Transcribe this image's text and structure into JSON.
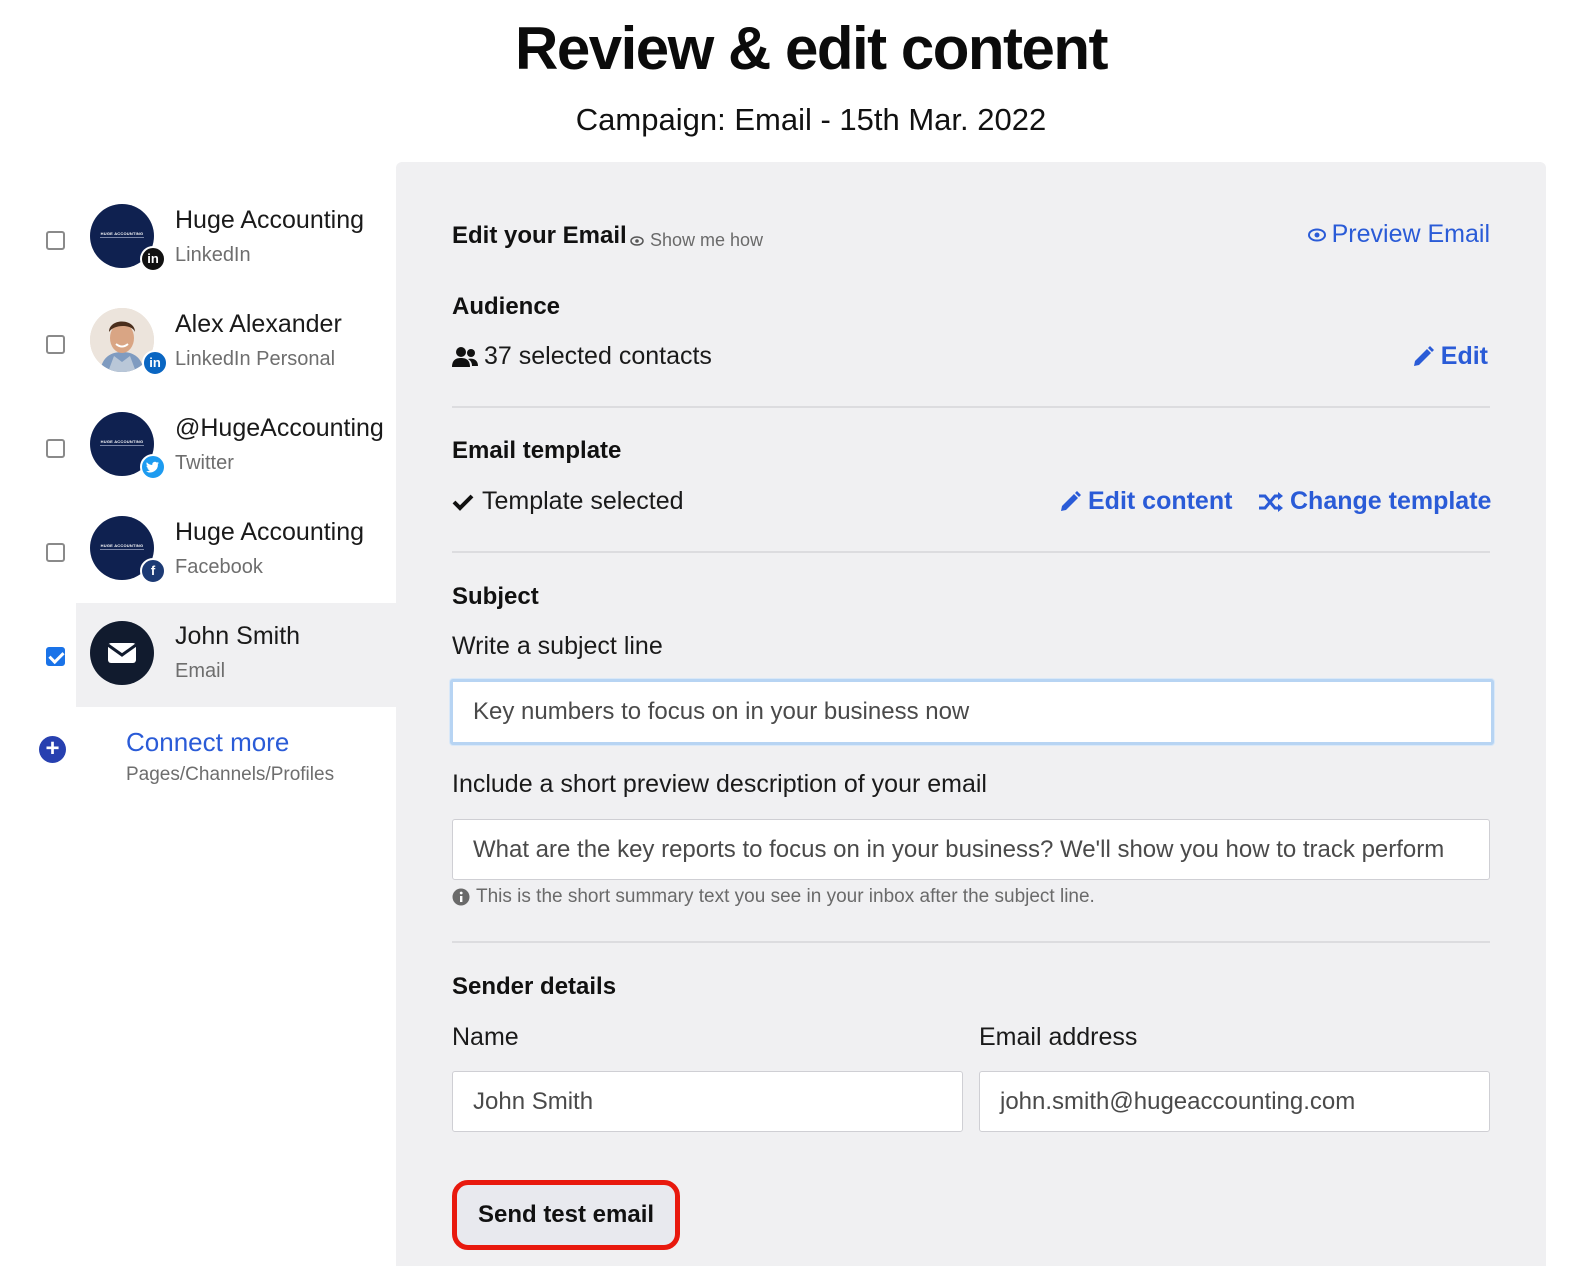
{
  "header": {
    "title": "Review & edit content",
    "subtitle": "Campaign: Email - 15th Mar. 2022"
  },
  "sidebar": {
    "accounts": [
      {
        "name": "Huge Accounting",
        "type": "LinkedIn",
        "checked": false,
        "logo_text": "HUGE ACCOUNTING"
      },
      {
        "name": "Alex Alexander",
        "type": "LinkedIn Personal",
        "checked": false
      },
      {
        "name": "@HugeAccounting",
        "type": "Twitter",
        "checked": false,
        "logo_text": "HUGE ACCOUNTING"
      },
      {
        "name": "Huge Accounting",
        "type": "Facebook",
        "checked": false,
        "logo_text": "HUGE ACCOUNTING"
      },
      {
        "name": "John Smith",
        "type": "Email",
        "checked": true
      }
    ],
    "connect_more": {
      "label": "Connect more",
      "sub": "Pages/Channels/Profiles"
    }
  },
  "editor": {
    "title": "Edit your Email",
    "show_me_how": "Show me how",
    "preview": "Preview Email",
    "audience": {
      "heading": "Audience",
      "contacts": "37 selected contacts",
      "edit": "Edit"
    },
    "template": {
      "heading": "Email template",
      "status": "Template selected",
      "edit_content": "Edit content",
      "change": "Change template"
    },
    "subject": {
      "heading": "Subject",
      "line_label": "Write a subject line",
      "line_value": "Key numbers to focus on in your business now",
      "preview_label": "Include a short preview description of your email",
      "preview_value": "What are the key reports to focus on in your business? We'll show you how to track perform",
      "hint": "This is the short summary text you see in your inbox after the subject line."
    },
    "sender": {
      "heading": "Sender details",
      "name_label": "Name",
      "name_value": "John Smith",
      "email_label": "Email address",
      "email_value": "john.smith@hugeaccounting.com"
    },
    "send_test": "Send test email"
  },
  "colors": {
    "accent": "#2a5bd7",
    "panel": "#f0f0f2",
    "highlight": "#e8190e"
  }
}
